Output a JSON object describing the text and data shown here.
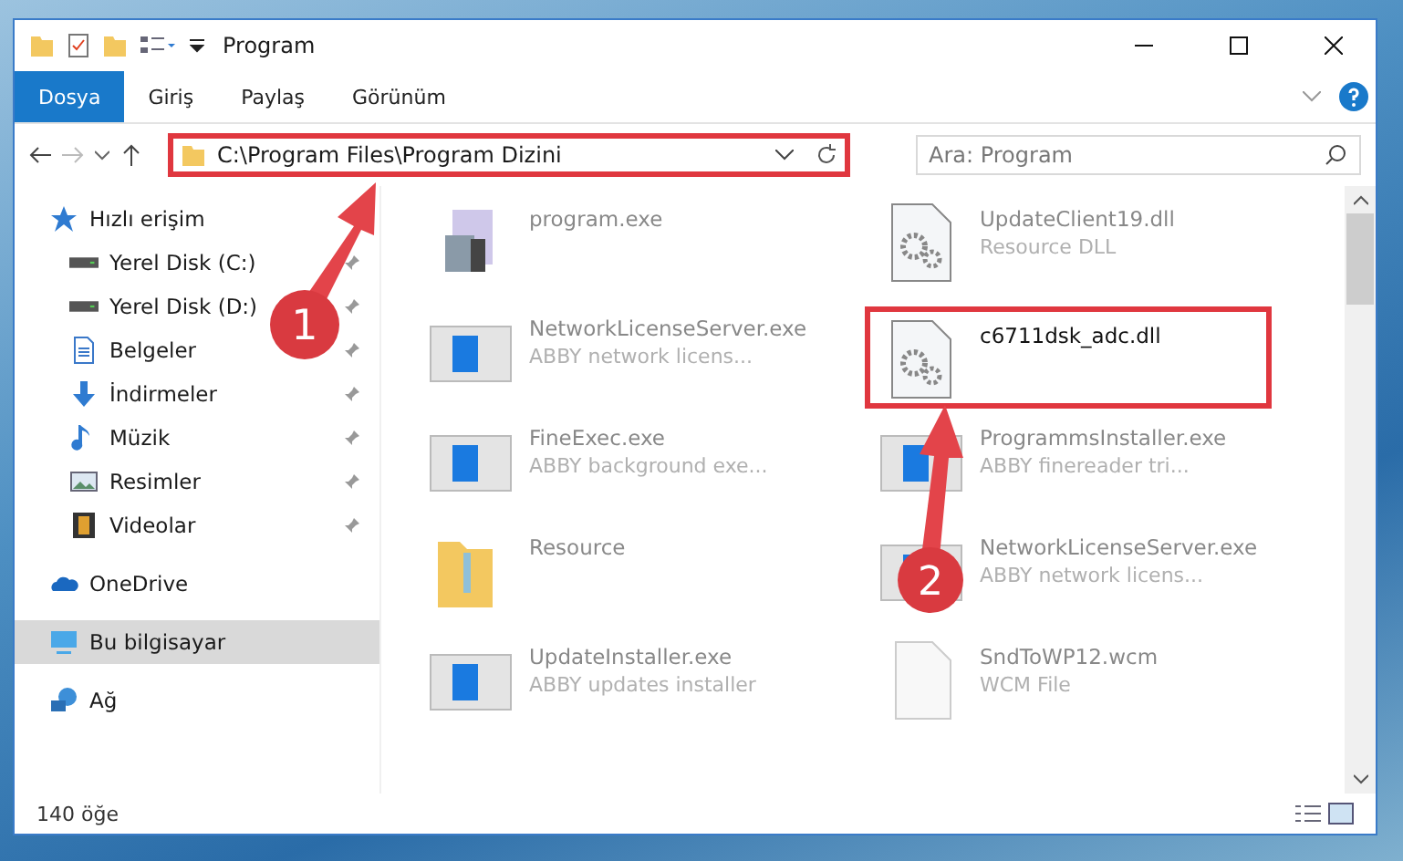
{
  "window": {
    "title": "Program"
  },
  "ribbon_tabs": [
    {
      "label": "Dosya",
      "selected": true
    },
    {
      "label": "Giriş",
      "selected": false
    },
    {
      "label": "Paylaş",
      "selected": false
    },
    {
      "label": "Görünüm",
      "selected": false
    }
  ],
  "address": {
    "path": "C:\\Program Files\\Program Dizini",
    "highlighted": true
  },
  "search": {
    "placeholder": "Ara: Program"
  },
  "sidebar": {
    "items": [
      {
        "label": "Hızlı erişim",
        "kind": "star",
        "selected": false,
        "children": [
          {
            "label": "Yerel Disk (C:)",
            "kind": "drive",
            "pinned": true,
            "selected": false
          },
          {
            "label": "Yerel Disk (D:)",
            "kind": "drive",
            "pinned": true,
            "selected": false
          },
          {
            "label": "Belgeler",
            "kind": "document",
            "pinned": true,
            "selected": false
          },
          {
            "label": "İndirmeler",
            "kind": "download",
            "pinned": true,
            "selected": false
          },
          {
            "label": "Müzik",
            "kind": "music",
            "pinned": true,
            "selected": false
          },
          {
            "label": "Resimler",
            "kind": "image",
            "pinned": true,
            "selected": false
          },
          {
            "label": "Videolar",
            "kind": "video",
            "pinned": true,
            "selected": false
          }
        ]
      },
      {
        "label": "OneDrive",
        "kind": "cloud",
        "selected": false
      },
      {
        "label": "Bu bilgisayar",
        "kind": "computer",
        "selected": true
      },
      {
        "label": "Ağ",
        "kind": "network",
        "selected": false
      }
    ]
  },
  "files": [
    {
      "name": "program.exe",
      "kind": "setup",
      "highlighted": false
    },
    {
      "name": "UpdateClient19.dll",
      "description": "Resource DLL",
      "kind": "dll",
      "highlighted": false
    },
    {
      "name": "NetworkLicenseServer.exe",
      "description": "ABBY network licens...",
      "kind": "app",
      "highlighted": false
    },
    {
      "name": "c6711dsk_adc.dll",
      "kind": "dll",
      "highlighted": true
    },
    {
      "name": "FineExec.exe",
      "description": "ABBY background exe...",
      "kind": "app",
      "highlighted": false
    },
    {
      "name": "ProgrammsInstaller.exe",
      "description": "ABBY finereader tri...",
      "kind": "app",
      "highlighted": false
    },
    {
      "name": "Resource",
      "kind": "folder",
      "highlighted": false
    },
    {
      "name": "NetworkLicenseServer.exe",
      "description": "ABBY network licens...",
      "kind": "app",
      "highlighted": false
    },
    {
      "name": "UpdateInstaller.exe",
      "description": "ABBY updates installer",
      "kind": "app",
      "highlighted": false
    },
    {
      "name": "SndToWP12.wcm",
      "description": "WCM File",
      "kind": "file",
      "highlighted": false
    }
  ],
  "annotations": [
    {
      "number": "1"
    },
    {
      "number": "2"
    }
  ],
  "status_bar": {
    "count": "140 öğe"
  }
}
